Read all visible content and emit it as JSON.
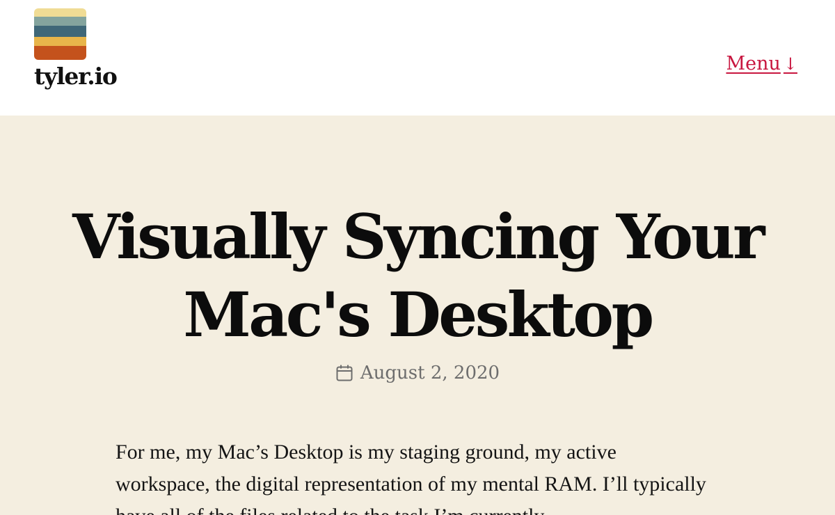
{
  "site": {
    "title": "tyler.io",
    "logo_colors": [
      "#f0dc95",
      "#84a49e",
      "#3f6778",
      "#e8b54a",
      "#c4521c"
    ]
  },
  "header": {
    "menu_label": "Menu",
    "menu_arrow": "↓",
    "menu_color": "#c8163f"
  },
  "post": {
    "title": "Visually Syncing Your Mac's Desktop",
    "date": "August 2, 2020",
    "date_icon": "calendar-icon",
    "paragraphs": [
      "For me, my Mac’s Desktop is my staging ground, my active workspace, the digital representation of my mental RAM. I’ll typically have all of the files related to the task I’m currently"
    ]
  },
  "colors": {
    "page_background": "#f4eee0",
    "header_background": "#ffffff"
  }
}
